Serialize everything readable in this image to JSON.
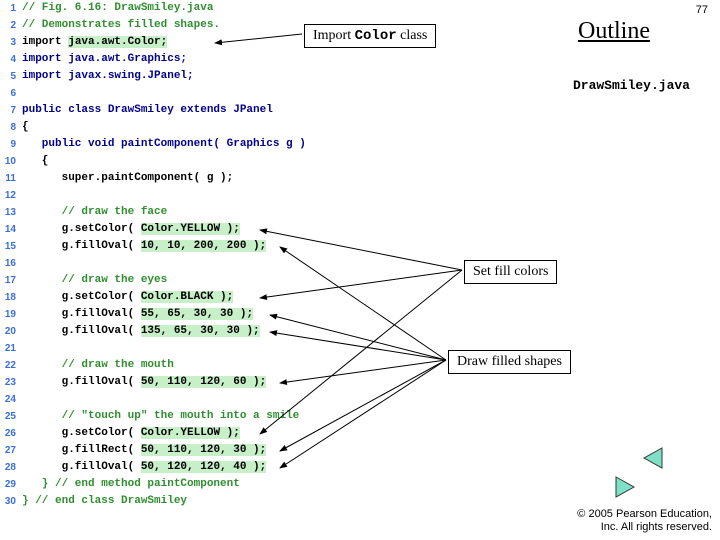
{
  "page_number": "77",
  "outline": "Outline",
  "filename": "DrawSmiley.java",
  "callouts": {
    "import": {
      "prefix": "Import ",
      "mono": "Color",
      "suffix": " class"
    },
    "setfill": "Set fill colors",
    "drawshapes": "Draw filled shapes"
  },
  "copyright": {
    "l1": "© 2005 Pearson Education,",
    "l2": "Inc. All rights reserved."
  },
  "code": [
    {
      "n": "1",
      "cls": "c-comment",
      "t": "// Fig. 6.16: DrawSmiley.java"
    },
    {
      "n": "2",
      "cls": "c-comment",
      "t": "// Demonstrates filled shapes."
    },
    {
      "n": "3",
      "pre": "import ",
      "hl": "java.awt.Color;"
    },
    {
      "n": "4",
      "cls": "c-key",
      "t": "import java.awt.Graphics;"
    },
    {
      "n": "5",
      "cls": "c-key",
      "t": "import javax.swing.JPanel;"
    },
    {
      "n": "6",
      "cls": "c-plain",
      "t": ""
    },
    {
      "n": "7",
      "cls": "c-key",
      "t": "public class DrawSmiley extends JPanel"
    },
    {
      "n": "8",
      "cls": "c-plain",
      "t": "{"
    },
    {
      "n": "9",
      "cls": "c-key",
      "t": "   public void paintComponent( Graphics g )"
    },
    {
      "n": "10",
      "cls": "c-plain",
      "t": "   {"
    },
    {
      "n": "11",
      "cls": "c-plain",
      "t": "      super.paintComponent( g );"
    },
    {
      "n": "12",
      "cls": "c-plain",
      "t": ""
    },
    {
      "n": "13",
      "cls": "c-comment",
      "t": "      // draw the face"
    },
    {
      "n": "14",
      "pre": "      g.setColor( ",
      "hl": "Color.YELLOW );"
    },
    {
      "n": "15",
      "pre": "      g.fillOval( ",
      "hl": "10, 10, 200, 200 );"
    },
    {
      "n": "16",
      "cls": "c-plain",
      "t": ""
    },
    {
      "n": "17",
      "cls": "c-comment",
      "t": "      // draw the eyes"
    },
    {
      "n": "18",
      "pre": "      g.setColor( ",
      "hl": "Color.BLACK );"
    },
    {
      "n": "19",
      "pre": "      g.fillOval( ",
      "hl": "55, 65, 30, 30 );"
    },
    {
      "n": "20",
      "pre": "      g.fillOval( ",
      "hl": "135, 65, 30, 30 );"
    },
    {
      "n": "21",
      "cls": "c-plain",
      "t": ""
    },
    {
      "n": "22",
      "cls": "c-comment",
      "t": "      // draw the mouth"
    },
    {
      "n": "23",
      "pre": "      g.fillOval( ",
      "hl": "50, 110, 120, 60 );"
    },
    {
      "n": "24",
      "cls": "c-plain",
      "t": ""
    },
    {
      "n": "25",
      "cls": "c-comment",
      "t": "      // \"touch up\" the mouth into a smile"
    },
    {
      "n": "26",
      "pre": "      g.setColor( ",
      "hl": "Color.YELLOW );"
    },
    {
      "n": "27",
      "pre": "      g.fillRect( ",
      "hl": "50, 110, 120, 30 );"
    },
    {
      "n": "28",
      "pre": "      g.fillOval( ",
      "hl": "50, 120, 120, 40 );"
    },
    {
      "n": "29",
      "cls": "c-comment",
      "t": "   } // end method paintComponent"
    },
    {
      "n": "30",
      "cls": "c-comment",
      "t": "} // end class DrawSmiley"
    }
  ]
}
